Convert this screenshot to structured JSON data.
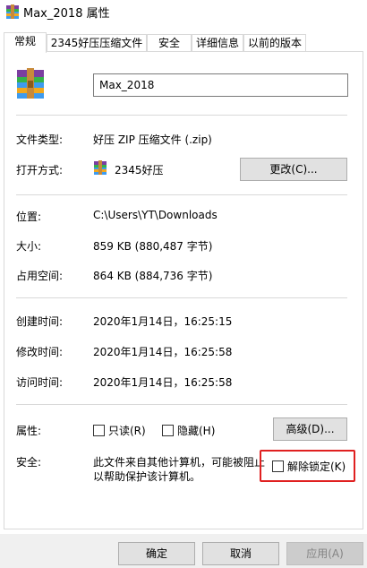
{
  "window": {
    "title": "Max_2018 属性"
  },
  "tabs": [
    {
      "label": "常规",
      "active": true
    },
    {
      "label": "2345好压压缩文件",
      "active": false
    },
    {
      "label": "安全",
      "active": false
    },
    {
      "label": "详细信息",
      "active": false
    },
    {
      "label": "以前的版本",
      "active": false
    }
  ],
  "file": {
    "name": "Max_2018"
  },
  "props": {
    "type_label": "文件类型:",
    "type_value": "好压 ZIP 压缩文件 (.zip)",
    "opens_label": "打开方式:",
    "opens_value": "2345好压",
    "change_button": "更改(C)...",
    "location_label": "位置:",
    "location_value": "C:\\Users\\YT\\Downloads",
    "size_label": "大小:",
    "size_value": "859 KB (880,487 字节)",
    "disk_label": "占用空间:",
    "disk_value": "864 KB (884,736 字节)",
    "created_label": "创建时间:",
    "created_value": "2020年1月14日，16:25:15",
    "modified_label": "修改时间:",
    "modified_value": "2020年1月14日，16:25:58",
    "accessed_label": "访问时间:",
    "accessed_value": "2020年1月14日，16:25:58",
    "attrs_label": "属性:",
    "readonly_label": "只读(R)",
    "hidden_label": "隐藏(H)",
    "advanced_button": "高级(D)...",
    "security_label": "安全:",
    "security_line1": "此文件来自其他计算机，可能被阻止",
    "security_line2": "以帮助保护该计算机。",
    "unblock_label": "解除锁定(K)"
  },
  "footer": {
    "ok": "确定",
    "cancel": "取消",
    "apply": "应用(A)"
  },
  "colors": {
    "highlight": "#e02020",
    "archive_icon": "#2f8de4"
  }
}
